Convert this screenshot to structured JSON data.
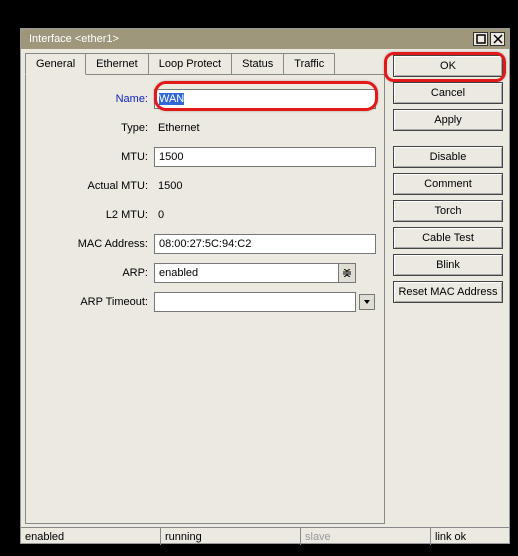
{
  "window": {
    "title": "Interface <ether1>"
  },
  "tabs": [
    "General",
    "Ethernet",
    "Loop Protect",
    "Status",
    "Traffic"
  ],
  "fields": {
    "name": {
      "label": "Name:",
      "value": "WAN"
    },
    "type": {
      "label": "Type:",
      "value": "Ethernet"
    },
    "mtu": {
      "label": "MTU:",
      "value": "1500"
    },
    "actual_mtu": {
      "label": "Actual MTU:",
      "value": "1500"
    },
    "l2_mtu": {
      "label": "L2 MTU:",
      "value": "0"
    },
    "mac": {
      "label": "MAC Address:",
      "value": "08:00:27:5C:94:C2"
    },
    "arp": {
      "label": "ARP:",
      "value": "enabled"
    },
    "arp_timeout": {
      "label": "ARP Timeout:",
      "value": ""
    }
  },
  "buttons": {
    "ok": "OK",
    "cancel": "Cancel",
    "apply": "Apply",
    "disable": "Disable",
    "comment": "Comment",
    "torch": "Torch",
    "cable_test": "Cable Test",
    "blink": "Blink",
    "reset_mac": "Reset MAC Address"
  },
  "status": {
    "enabled": "enabled",
    "running": "running",
    "slave": "slave",
    "link": "link ok"
  }
}
